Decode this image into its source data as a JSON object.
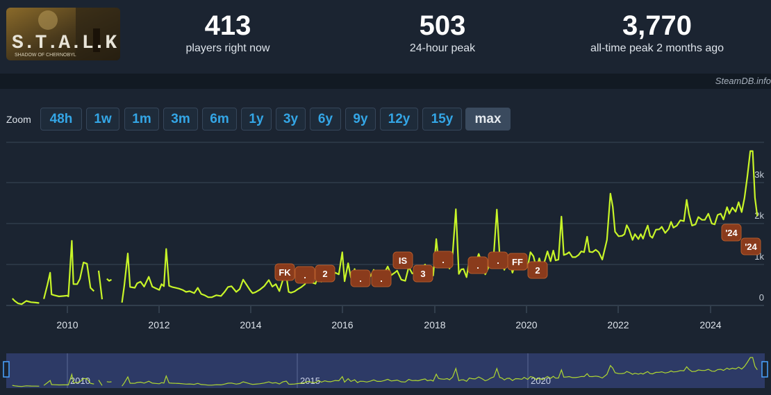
{
  "game": {
    "logo_text": "S.T.A.L.K.E.R",
    "logo_sub": "SHADOW OF CHERNOBYL"
  },
  "stats": [
    {
      "value": "413",
      "label": "players right now"
    },
    {
      "value": "503",
      "label": "24-hour peak"
    },
    {
      "value": "3,770",
      "label": "all-time peak 2 months ago"
    }
  ],
  "credit": "SteamDB.info",
  "zoom": {
    "label": "Zoom",
    "options": [
      "48h",
      "1w",
      "1m",
      "3m",
      "6m",
      "1y",
      "3y",
      "6y",
      "9y",
      "12y",
      "15y",
      "max"
    ],
    "selected": "max"
  },
  "colors": {
    "line": "#c8f528",
    "annotation": "#8a3b1c",
    "button_text": "#34a6e6"
  },
  "chart_data": {
    "type": "line",
    "series": [
      {
        "values": [
          [
            2008.7,
            170
          ],
          [
            2008.8,
            110
          ],
          [
            2008.95,
            50
          ],
          [
            2009.1,
            30
          ],
          [
            2009.3,
            110
          ],
          [
            2009.5,
            80
          ],
          [
            2009.7,
            70
          ],
          [
            2009.85,
            60
          ],
          [
            2010.0,
            null
          ],
          [
            2010.05,
            160
          ],
          [
            2010.2,
            500
          ],
          [
            2010.32,
            800
          ],
          [
            2010.38,
            270
          ],
          [
            2010.5,
            250
          ],
          [
            2010.7,
            220
          ],
          [
            2010.9,
            230
          ],
          [
            2011.05,
            240
          ],
          [
            2011.1,
            220
          ],
          [
            2011.25,
            1580
          ],
          [
            2011.32,
            520
          ],
          [
            2011.48,
            520
          ],
          [
            2011.6,
            650
          ],
          [
            2011.75,
            1050
          ],
          [
            2011.9,
            1020
          ],
          [
            2012.05,
            430
          ],
          [
            2012.2,
            350
          ],
          [
            2012.3,
            null
          ],
          [
            2012.4,
            850
          ],
          [
            2012.55,
            150
          ],
          [
            2012.65,
            null
          ],
          [
            2012.75,
            650
          ],
          [
            2012.85,
            600
          ],
          [
            2012.95,
            630
          ],
          [
            2013.0,
            null
          ],
          [
            2013.4,
            70
          ],
          [
            2013.5,
            480
          ],
          [
            2013.65,
            1270
          ],
          [
            2013.75,
            450
          ],
          [
            2013.85,
            440
          ],
          [
            2013.95,
            430
          ],
          [
            2014.05,
            540
          ],
          [
            2014.2,
            580
          ],
          [
            2014.35,
            460
          ],
          [
            2014.55,
            700
          ],
          [
            2014.7,
            460
          ],
          [
            2014.85,
            420
          ],
          [
            2015.0,
            380
          ],
          [
            2015.1,
            520
          ],
          [
            2015.2,
            470
          ],
          [
            2015.3,
            1380
          ],
          [
            2015.42,
            480
          ],
          [
            2015.55,
            450
          ],
          [
            2015.7,
            430
          ],
          [
            2015.85,
            410
          ],
          [
            2016.0,
            380
          ],
          [
            2016.15,
            330
          ],
          [
            2016.3,
            350
          ],
          [
            2016.5,
            300
          ],
          [
            2016.65,
            430
          ],
          [
            2016.8,
            280
          ],
          [
            2016.95,
            250
          ],
          [
            2017.1,
            200
          ],
          [
            2017.25,
            200
          ],
          [
            2017.45,
            250
          ],
          [
            2017.65,
            230
          ],
          [
            2017.8,
            330
          ],
          [
            2017.95,
            450
          ],
          [
            2018.1,
            470
          ],
          [
            2018.3,
            330
          ],
          [
            2018.45,
            400
          ],
          [
            2018.6,
            630
          ],
          [
            2018.75,
            500
          ],
          [
            2018.9,
            370
          ],
          [
            2019.0,
            300
          ],
          [
            2019.12,
            320
          ],
          [
            2019.3,
            380
          ],
          [
            2019.5,
            470
          ],
          [
            2019.7,
            620
          ],
          [
            2019.85,
            460
          ],
          [
            2020.0,
            520
          ],
          [
            2020.15,
            350
          ],
          [
            2020.3,
            620
          ],
          [
            2020.45,
            720
          ],
          [
            2020.55,
            330
          ],
          [
            2020.65,
            310
          ],
          [
            2020.8,
            340
          ],
          [
            2020.95,
            400
          ],
          [
            2021.1,
            450
          ],
          [
            2021.25,
            520
          ],
          [
            2021.38,
            680
          ],
          [
            2021.55,
            560
          ],
          [
            2021.7,
            530
          ],
          [
            2021.85,
            790
          ],
          [
            2021.95,
            580
          ],
          [
            2022.1,
            750
          ],
          [
            2022.22,
            660
          ],
          [
            2022.35,
            640
          ],
          [
            2022.55,
            800
          ],
          [
            2022.7,
            760
          ],
          [
            2022.85,
            1300
          ],
          [
            2022.95,
            590
          ],
          [
            2023.1,
            1030
          ],
          [
            2023.22,
            680
          ],
          [
            2023.38,
            890
          ],
          [
            2023.5,
            530
          ],
          [
            2023.62,
            700
          ],
          [
            2023.75,
            690
          ],
          [
            2023.9,
            600
          ],
          [
            2024.05,
            710
          ],
          [
            2024.2,
            870
          ],
          [
            2024.35,
            680
          ],
          [
            2024.5,
            680
          ],
          [
            2024.65,
            790
          ],
          [
            2024.8,
            950
          ],
          [
            2024.95,
            740
          ],
          [
            2025.1,
            800
          ],
          [
            2025.2,
            850
          ],
          [
            2025.38,
            630
          ],
          [
            2025.55,
            600
          ],
          [
            2025.7,
            940
          ],
          [
            2025.85,
            780
          ],
          [
            2026.0,
            810
          ],
          [
            2026.1,
            760
          ],
          [
            2026.25,
            900
          ],
          [
            2026.4,
            1000
          ],
          [
            2026.5,
            760
          ],
          [
            2026.65,
            860
          ],
          [
            2026.75,
            730
          ],
          [
            2026.88,
            1620
          ],
          [
            2026.98,
            1070
          ],
          [
            2027.08,
            1000
          ],
          [
            2027.22,
            960
          ],
          [
            2027.35,
            1040
          ],
          [
            2027.45,
            900
          ],
          [
            2027.58,
            1240
          ],
          [
            2027.72,
            2350
          ],
          [
            2027.85,
            770
          ],
          [
            2027.95,
            880
          ],
          [
            2028.05,
            890
          ],
          [
            2028.18,
            690
          ],
          [
            2028.3,
            1110
          ],
          [
            2028.42,
            1030
          ],
          [
            2028.55,
            1000
          ],
          [
            2028.7,
            1260
          ],
          [
            2028.85,
            1020
          ],
          [
            2028.98,
            760
          ],
          [
            2029.1,
            900
          ],
          [
            2029.22,
            1120
          ],
          [
            2029.35,
            1270
          ],
          [
            2029.48,
            2340
          ],
          [
            2029.6,
            1200
          ],
          [
            2029.7,
            1100
          ],
          [
            2029.8,
            870
          ],
          [
            2029.92,
            1080
          ],
          [
            2030.02,
            1090
          ],
          [
            2030.15,
            800
          ],
          [
            2030.28,
            1030
          ],
          [
            2030.4,
            1020
          ],
          [
            2030.55,
            960
          ],
          [
            2030.65,
            1200
          ],
          [
            2030.8,
            940
          ],
          [
            2030.92,
            1300
          ],
          [
            2031.05,
            1200
          ],
          [
            2031.18,
            910
          ],
          [
            2031.3,
            1150
          ],
          [
            2031.42,
            900
          ],
          [
            2031.55,
            1120
          ],
          [
            2031.65,
            1320
          ],
          [
            2031.78,
            1080
          ],
          [
            2031.9,
            1340
          ],
          [
            2032.0,
            1100
          ],
          [
            2032.12,
            1120
          ],
          [
            2032.25,
            2170
          ],
          [
            2032.35,
            1230
          ],
          [
            2032.48,
            1260
          ],
          [
            2032.58,
            1300
          ],
          [
            2032.72,
            1180
          ],
          [
            2032.85,
            1180
          ],
          [
            2032.98,
            1230
          ],
          [
            2033.1,
            1320
          ],
          [
            2033.22,
            1300
          ],
          [
            2033.35,
            1680
          ],
          [
            2033.45,
            1310
          ],
          [
            2033.58,
            1300
          ],
          [
            2033.72,
            1360
          ],
          [
            2033.85,
            1300
          ],
          [
            2034.0,
            1120
          ],
          [
            2034.2,
            1600
          ],
          [
            2034.35,
            2730
          ],
          [
            2034.45,
            2410
          ],
          [
            2034.55,
            1800
          ],
          [
            2034.7,
            1690
          ],
          [
            2034.85,
            1700
          ],
          [
            2034.95,
            1740
          ],
          [
            2035.05,
            1960
          ],
          [
            2035.15,
            1850
          ],
          [
            2035.3,
            1600
          ],
          [
            2035.4,
            1740
          ],
          [
            2035.55,
            1620
          ],
          [
            2035.65,
            1740
          ],
          [
            2035.75,
            1630
          ],
          [
            2035.85,
            1810
          ],
          [
            2035.95,
            1950
          ],
          [
            2036.05,
            1700
          ],
          [
            2036.15,
            1650
          ],
          [
            2036.3,
            1850
          ],
          [
            2036.45,
            1860
          ],
          [
            2036.55,
            1920
          ],
          [
            2036.7,
            1770
          ],
          [
            2036.85,
            1870
          ],
          [
            2036.95,
            2040
          ],
          [
            2037.05,
            1900
          ],
          [
            2037.2,
            1950
          ],
          [
            2037.35,
            2080
          ],
          [
            2037.5,
            2060
          ],
          [
            2037.62,
            2580
          ],
          [
            2037.72,
            2230
          ],
          [
            2037.85,
            1950
          ],
          [
            2038.0,
            1980
          ],
          [
            2038.12,
            2160
          ],
          [
            2038.28,
            2090
          ],
          [
            2038.4,
            2090
          ],
          [
            2038.55,
            2240
          ],
          [
            2038.7,
            2000
          ],
          [
            2038.82,
            1980
          ],
          [
            2038.95,
            2210
          ],
          [
            2039.08,
            2240
          ],
          [
            2039.2,
            2100
          ],
          [
            2039.35,
            2400
          ],
          [
            2039.45,
            2240
          ],
          [
            2039.58,
            2390
          ],
          [
            2039.72,
            2290
          ],
          [
            2039.85,
            2520
          ],
          [
            2039.98,
            2280
          ],
          [
            2040.1,
            2620
          ],
          [
            2040.22,
            3140
          ],
          [
            2040.35,
            3770
          ],
          [
            2040.45,
            3770
          ],
          [
            2040.55,
            2630
          ],
          [
            2040.65,
            2180
          ]
        ]
      }
    ],
    "x_ticks": [
      "2010",
      "2012",
      "2014",
      "2016",
      "2018",
      "2020",
      "2022",
      "2024"
    ],
    "y_ticks": [
      "0",
      "1k",
      "2k",
      "3k"
    ],
    "ylim": [
      0,
      4000
    ],
    "annotations": [
      "FK",
      ".",
      "2",
      ".",
      ".",
      "IS",
      "3",
      ".",
      ".",
      ".",
      "FF",
      "2",
      "'24",
      "'24"
    ],
    "navigator_labels": [
      "2010",
      "2015",
      "2020"
    ],
    "grid": true,
    "legend": "none"
  }
}
